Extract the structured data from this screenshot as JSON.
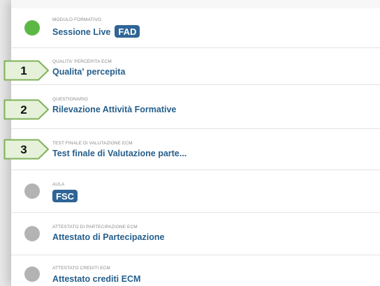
{
  "items": [
    {
      "status": "done",
      "category": "MODULO FORMATIVO",
      "title": "Sessione Live",
      "badge": "FAD"
    },
    {
      "status": "none",
      "step": "1",
      "category": "QUALITA' PERCEPITA ECM",
      "title": "Qualita' percepita"
    },
    {
      "status": "none",
      "step": "2",
      "category": "QUESTIONARIO",
      "title": "Rilevazione Attività Formative"
    },
    {
      "status": "none",
      "step": "3",
      "category": "TEST FINALE DI VALUTAZIONE ECM",
      "title": "Test finale di Valutazione parte..."
    },
    {
      "status": "pending",
      "category": "AULA",
      "badge": "FSC"
    },
    {
      "status": "pending",
      "category": "ATTESTATO DI PARTECIPAZIONE ECM",
      "title": "Attestato di Partecipazione"
    },
    {
      "status": "pending",
      "category": "ATTESTATO CREDITI ECM",
      "title": "Attestato crediti ECM"
    }
  ],
  "colors": {
    "done_dot": "#5cb845",
    "pending_dot": "#b3b3b3",
    "title_text": "#265f8c",
    "badge_bg": "#2f6496",
    "callout_fill": "#e6f1da",
    "callout_border": "#7fb259"
  }
}
